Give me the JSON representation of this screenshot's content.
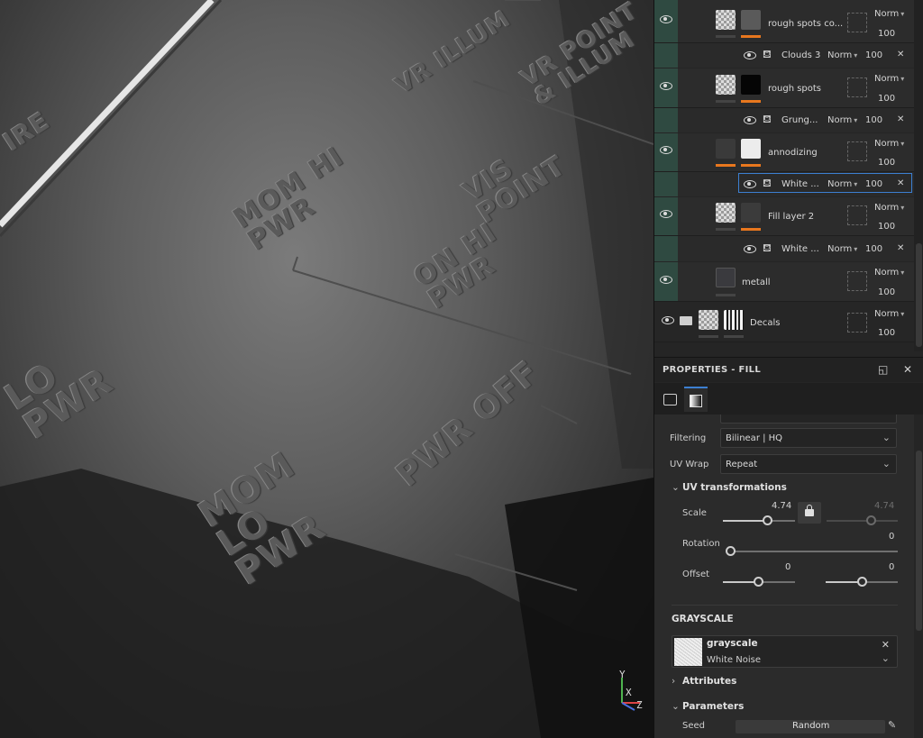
{
  "viewport": {
    "engravings": [
      "MOM HI\nPWR",
      "ON HI\nPWR",
      "VIS\nPOINT",
      "VR ILLUM",
      "VR POINT\n& ILLUM",
      "MOM\nLO\nPWR",
      "PWR OFF",
      "LO\nPWR",
      "IRE"
    ],
    "axis": {
      "y": "Y",
      "x": "X",
      "z": "Z"
    }
  },
  "layers": {
    "items": [
      {
        "name": "rough spots co...",
        "blend": "Norm",
        "opacity": "100"
      },
      {
        "name": "rough spots",
        "blend": "Norm",
        "opacity": "100"
      },
      {
        "name": "annodizing",
        "blend": "Norm",
        "opacity": "100"
      },
      {
        "name": "Fill layer 2",
        "blend": "Norm",
        "opacity": "100"
      },
      {
        "name": "metall",
        "blend": "Norm",
        "opacity": "100"
      },
      {
        "name": "Decals",
        "blend": "Norm",
        "opacity": "100"
      }
    ],
    "effects": [
      {
        "name": "Clouds 3",
        "blend": "Norm",
        "opacity": "100"
      },
      {
        "name": "Grung...",
        "blend": "Norm",
        "opacity": "100"
      },
      {
        "name": "White ...",
        "blend": "Norm",
        "opacity": "100"
      },
      {
        "name": "White ...",
        "blend": "Norm",
        "opacity": "100"
      }
    ]
  },
  "properties": {
    "title": "PROPERTIES - FILL",
    "filtering_label": "Filtering",
    "filtering_value": "Bilinear | HQ",
    "uvwrap_label": "UV Wrap",
    "uvwrap_value": "Repeat",
    "uv_section": "UV transformations",
    "scale_label": "Scale",
    "scale_value": "4.74",
    "scale_value2": "4.74",
    "rotation_label": "Rotation",
    "rotation_value": "0",
    "offset_label": "Offset",
    "offset_value1": "0",
    "offset_value2": "0",
    "grayscale_section": "GRAYSCALE",
    "resource_name": "grayscale",
    "resource_type": "White Noise",
    "attributes_section": "Attributes",
    "parameters_section": "Parameters",
    "seed_label": "Seed",
    "seed_value": "Random"
  },
  "colors": {
    "accent": "#e8771e",
    "selection": "#3c7fd1",
    "visibility_column": "#2f4a41"
  },
  "icons": [
    "eye-icon",
    "paint-bucket-icon",
    "close-icon",
    "folder-icon",
    "lock-icon",
    "pencil-icon",
    "chevron-down-icon",
    "maximize-icon"
  ]
}
